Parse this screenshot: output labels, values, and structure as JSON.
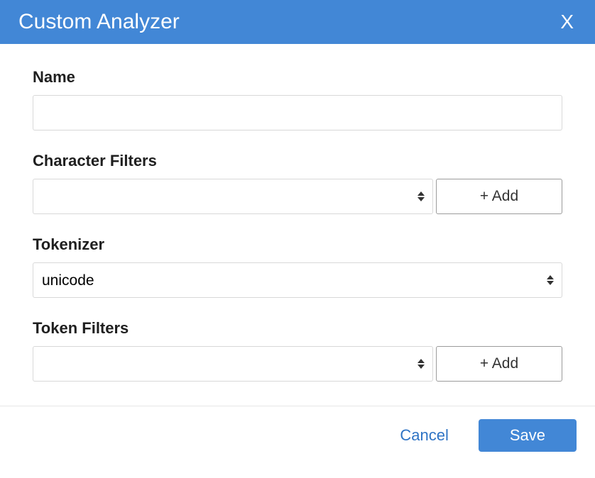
{
  "header": {
    "title": "Custom Analyzer",
    "close_label": "X"
  },
  "fields": {
    "name": {
      "label": "Name",
      "value": ""
    },
    "char_filters": {
      "label": "Character Filters",
      "selected": "",
      "add_label": "+ Add"
    },
    "tokenizer": {
      "label": "Tokenizer",
      "selected": "unicode"
    },
    "token_filters": {
      "label": "Token Filters",
      "selected": "",
      "add_label": "+ Add"
    }
  },
  "footer": {
    "cancel_label": "Cancel",
    "save_label": "Save"
  }
}
